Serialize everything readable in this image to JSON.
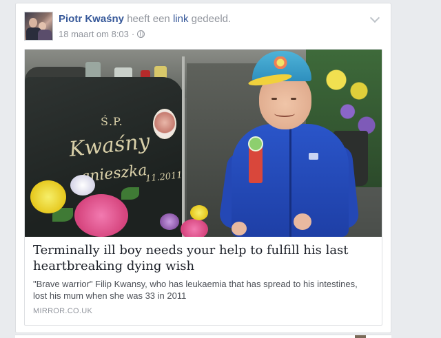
{
  "post": {
    "author": "Piotr Kwaśny",
    "action_prefix": " heeft een ",
    "action_link": "link",
    "action_suffix": " gedeeld.",
    "timestamp": "18 maart om 8:03",
    "separator": "·",
    "privacy_icon": "globe-icon",
    "options_icon": "chevron-down-icon"
  },
  "link_preview": {
    "title": "Terminally ill boy needs your help to fulfill his last heartbreaking dying wish",
    "description": "\"Brave warrior\" Filip Kwansy, who has leukaemia that has spread to his intestines, lost his mum when she was 33 in 2011",
    "domain": "MIRROR.CO.UK",
    "image_text": {
      "initials": "Ś.P.",
      "surname": "Kwaśny",
      "first_name": "gnieszka",
      "year": "11.2011"
    }
  },
  "colors": {
    "page_background": "#e9ebee",
    "author_link": "#365899",
    "meta_text": "#90949c",
    "title_text": "#1d2129",
    "jacket_blue": "#2448b5"
  }
}
